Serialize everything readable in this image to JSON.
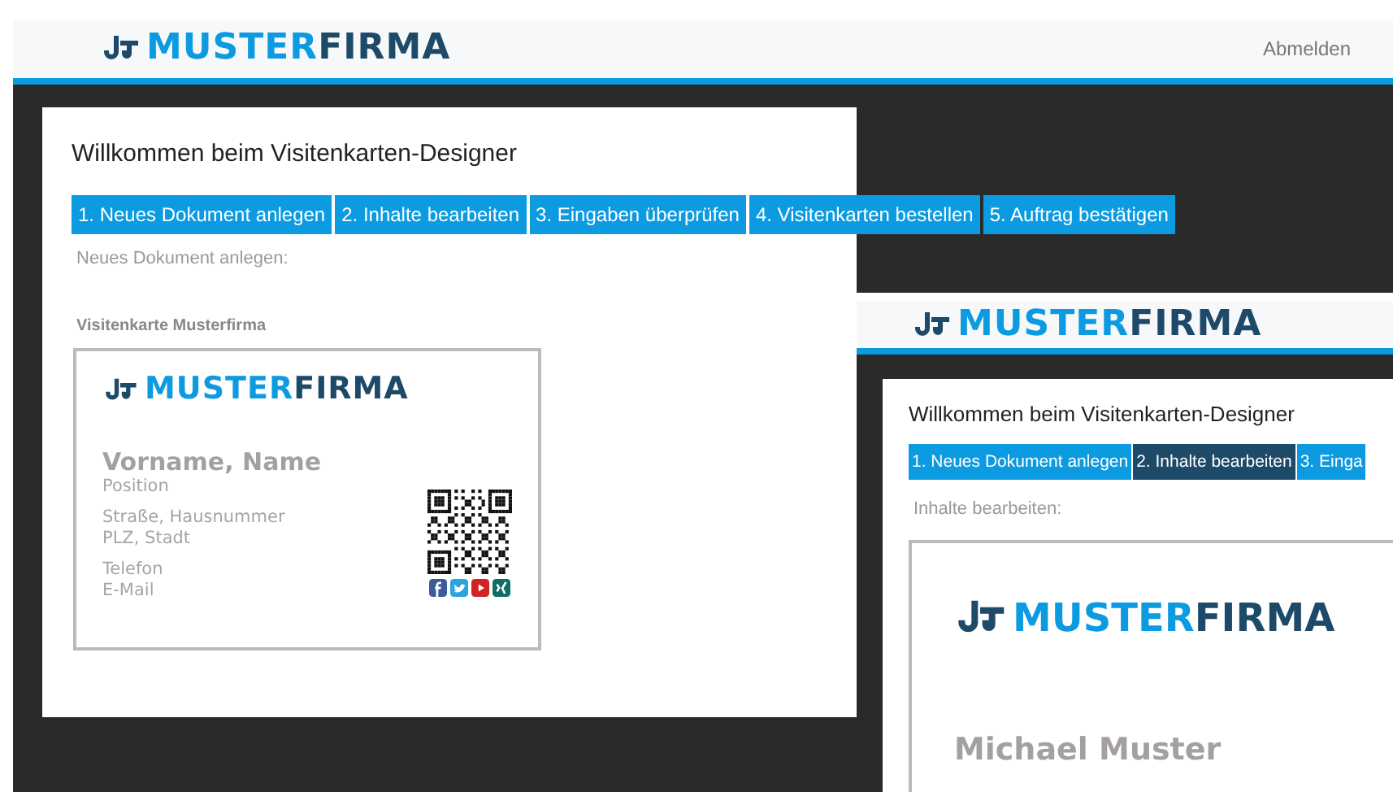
{
  "back": {
    "header": {
      "logo": {
        "first": "MUSTER",
        "second": "FIRMA"
      },
      "logout": "Abmelden"
    },
    "title": "Willkommen beim Visitenkarten-Designer",
    "tabs": [
      {
        "label": "1. Neues Dokument anlegen",
        "selected": false
      },
      {
        "label": "2. Inhalte bearbeiten",
        "selected": false
      },
      {
        "label": "3. Eingaben überprüfen",
        "selected": false
      },
      {
        "label": "4. Visitenkarten bestellen",
        "selected": false
      },
      {
        "label": "5. Auftrag bestätigen",
        "selected": false
      }
    ],
    "step_label": "Neues Dokument anlegen:",
    "card_title": "Visitenkarte Musterfirma",
    "card": {
      "logo": {
        "first": "MUSTER",
        "second": "FIRMA"
      },
      "name": "Vorname, Name",
      "position": "Position",
      "address": [
        "Straße, Hausnummer",
        "PLZ, Stadt"
      ],
      "contact": [
        "Telefon",
        "E-Mail"
      ]
    }
  },
  "front": {
    "header": {
      "logo": {
        "first": "MUSTER",
        "second": "FIRMA"
      }
    },
    "title": "Willkommen beim Visitenkarten-Designer",
    "tabs": [
      {
        "label": "1. Neues Dokument anlegen",
        "selected": false
      },
      {
        "label": "2. Inhalte bearbeiten",
        "selected": true
      },
      {
        "label": "3. Einga",
        "selected": false
      }
    ],
    "step_label": "Inhalte bearbeiten:",
    "card": {
      "logo": {
        "first": "MUSTER",
        "second": "FIRMA"
      },
      "name": "Michael Muster"
    }
  }
}
